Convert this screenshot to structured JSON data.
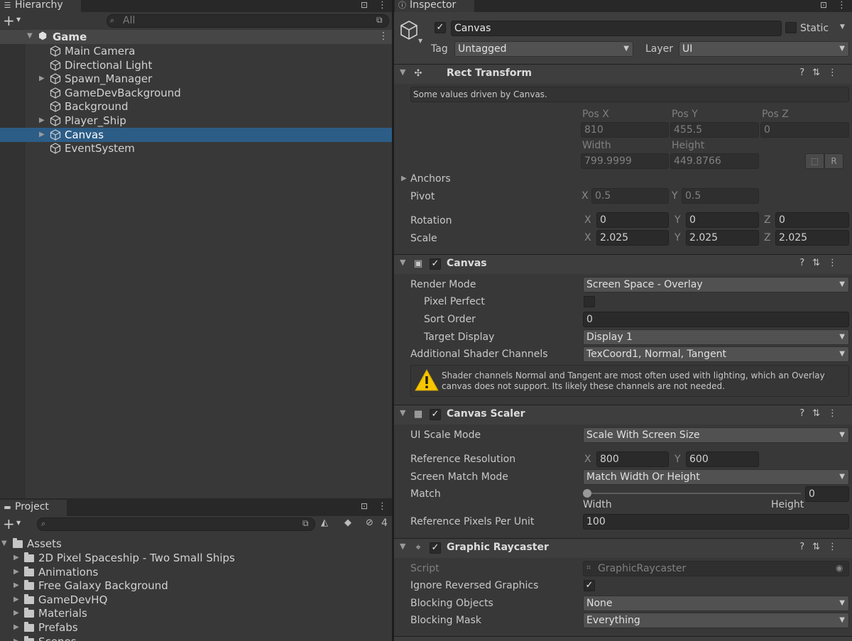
{
  "hierarchy": {
    "tab_label": "Hierarchy",
    "search_placeholder": "All",
    "scene_name": "Game",
    "items": [
      {
        "label": "Main Camera",
        "expandable": false,
        "selected": false
      },
      {
        "label": "Directional Light",
        "expandable": false,
        "selected": false
      },
      {
        "label": "Spawn_Manager",
        "expandable": true,
        "selected": false
      },
      {
        "label": "GameDevBackground",
        "expandable": false,
        "selected": false
      },
      {
        "label": "Background",
        "expandable": false,
        "selected": false
      },
      {
        "label": "Player_Ship",
        "expandable": true,
        "selected": false
      },
      {
        "label": "Canvas",
        "expandable": true,
        "selected": true
      },
      {
        "label": "EventSystem",
        "expandable": false,
        "selected": false
      }
    ]
  },
  "project": {
    "tab_label": "Project",
    "hidden_count": "4",
    "root": "Assets",
    "folders": [
      "2D Pixel Spaceship - Two Small Ships",
      "Animations",
      "Free Galaxy Background",
      "GameDevHQ",
      "Materials",
      "Prefabs",
      "Scenes"
    ]
  },
  "inspector": {
    "tab_label": "Inspector",
    "object_name": "Canvas",
    "static_label": "Static",
    "tag_label": "Tag",
    "tag_value": "Untagged",
    "layer_label": "Layer",
    "layer_value": "UI",
    "rect_transform": {
      "title": "Rect Transform",
      "driven_note": "Some values driven by Canvas.",
      "pos_x_label": "Pos X",
      "pos_y_label": "Pos Y",
      "pos_z_label": "Pos Z",
      "pos_x": "810",
      "pos_y": "455.5",
      "pos_z": "0",
      "width_label": "Width",
      "height_label": "Height",
      "width": "799.9999",
      "height": "449.8766",
      "anchors_label": "Anchors",
      "pivot_label": "Pivot",
      "pivot_x": "0.5",
      "pivot_y": "0.5",
      "rotation_label": "Rotation",
      "rot_x": "0",
      "rot_y": "0",
      "rot_z": "0",
      "scale_label": "Scale",
      "scale_x": "2.025",
      "scale_y": "2.025",
      "scale_z": "2.025",
      "blueprint_btn": "R"
    },
    "canvas": {
      "title": "Canvas",
      "render_mode_label": "Render Mode",
      "render_mode": "Screen Space - Overlay",
      "pixel_perfect_label": "Pixel Perfect",
      "sort_order_label": "Sort Order",
      "sort_order": "0",
      "target_display_label": "Target Display",
      "target_display": "Display 1",
      "shader_channels_label": "Additional Shader Channels",
      "shader_channels": "TexCoord1, Normal, Tangent",
      "warning": "Shader channels Normal and Tangent are most often used with lighting, which an Overlay canvas does not support. Its likely these channels are not needed."
    },
    "canvas_scaler": {
      "title": "Canvas Scaler",
      "ui_scale_mode_label": "UI Scale Mode",
      "ui_scale_mode": "Scale With Screen Size",
      "ref_res_label": "Reference Resolution",
      "ref_x": "800",
      "ref_y": "600",
      "match_mode_label": "Screen Match Mode",
      "match_mode": "Match Width Or Height",
      "match_label": "Match",
      "match_value": "0",
      "match_fraction": 0,
      "width_end": "Width",
      "height_end": "Height",
      "ppu_label": "Reference Pixels Per Unit",
      "ppu": "100"
    },
    "graphic_raycaster": {
      "title": "Graphic Raycaster",
      "script_label": "Script",
      "script": "GraphicRaycaster",
      "ignore_reversed_label": "Ignore Reversed Graphics",
      "blocking_objects_label": "Blocking Objects",
      "blocking_objects": "None",
      "blocking_mask_label": "Blocking Mask",
      "blocking_mask": "Everything"
    }
  },
  "axis": {
    "x": "X",
    "y": "Y",
    "z": "Z"
  },
  "icons": {
    "hierarchy_tab": "list-icon",
    "inspector_tab": "info-icon",
    "project_tab": "folder-icon"
  }
}
